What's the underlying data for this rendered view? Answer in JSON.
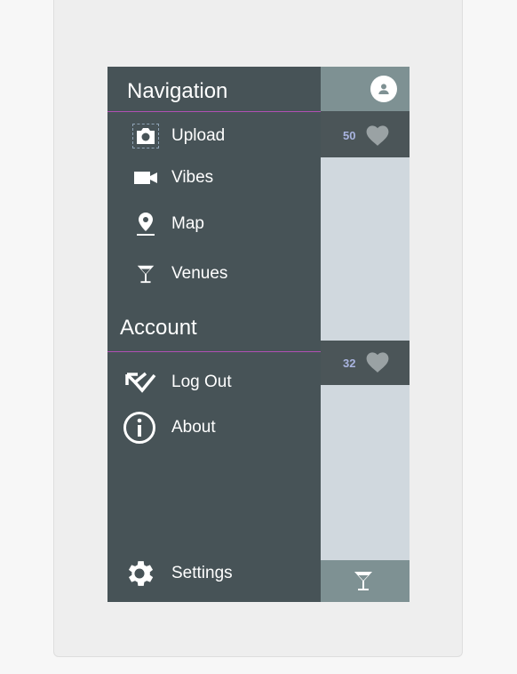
{
  "drawer": {
    "navigation_title": "Navigation",
    "account_title": "Account",
    "nav_items": [
      {
        "label": "Upload",
        "icon": "camera-icon"
      },
      {
        "label": "Vibes",
        "icon": "video-camera-icon"
      },
      {
        "label": "Map",
        "icon": "map-pin-icon"
      },
      {
        "label": "Venues",
        "icon": "martini-glass-icon"
      }
    ],
    "account_items": [
      {
        "label": "Log Out",
        "icon": "logout-check-icon"
      },
      {
        "label": "About",
        "icon": "info-icon"
      }
    ],
    "settings_label": "Settings",
    "divider_color": "#b04fb4"
  },
  "feed": {
    "posts": [
      {
        "likes": "50"
      },
      {
        "likes": "32"
      }
    ]
  },
  "colors": {
    "drawer_bg": "#475357",
    "topbar_bg": "#7e9193",
    "card_bar_bg": "#4b5558",
    "feed_bg": "#d0d8de",
    "like_count": "#a9b4e0"
  }
}
